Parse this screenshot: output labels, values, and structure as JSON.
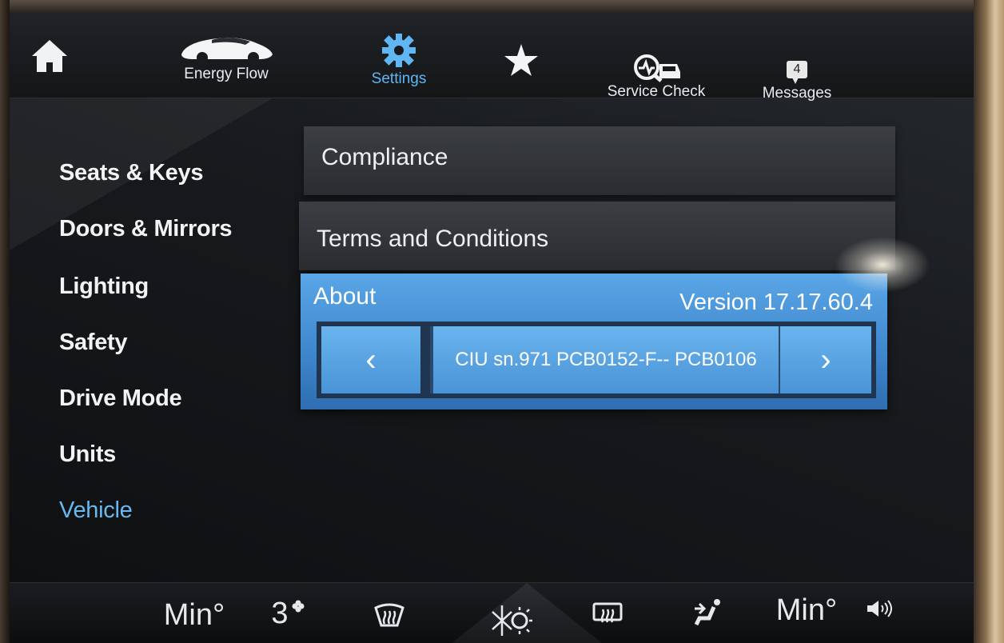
{
  "topnav": {
    "energy_flow": "Energy Flow",
    "settings": "Settings",
    "service_check": "Service Check",
    "messages": "Messages",
    "messages_count": "4"
  },
  "sidebar": {
    "items": [
      {
        "label": "Seats & Keys"
      },
      {
        "label": "Doors & Mirrors"
      },
      {
        "label": "Lighting"
      },
      {
        "label": "Safety"
      },
      {
        "label": "Drive Mode"
      },
      {
        "label": "Units"
      },
      {
        "label": "Vehicle"
      }
    ],
    "active": "Vehicle"
  },
  "content": {
    "rows": [
      {
        "label": "Compliance"
      },
      {
        "label": "Terms and Conditions"
      }
    ],
    "about": {
      "title": "About",
      "version": "Version 17.17.60.4",
      "prev": "‹",
      "serial": "CIU sn.971 PCB0152-F-- PCB0106",
      "next": "›"
    }
  },
  "climate": {
    "left_temp": "Min°",
    "fan_speed": "3",
    "right_temp": "Min°"
  },
  "colors": {
    "accent": "#5fb6f2",
    "about_blue": "#4a93d6"
  }
}
